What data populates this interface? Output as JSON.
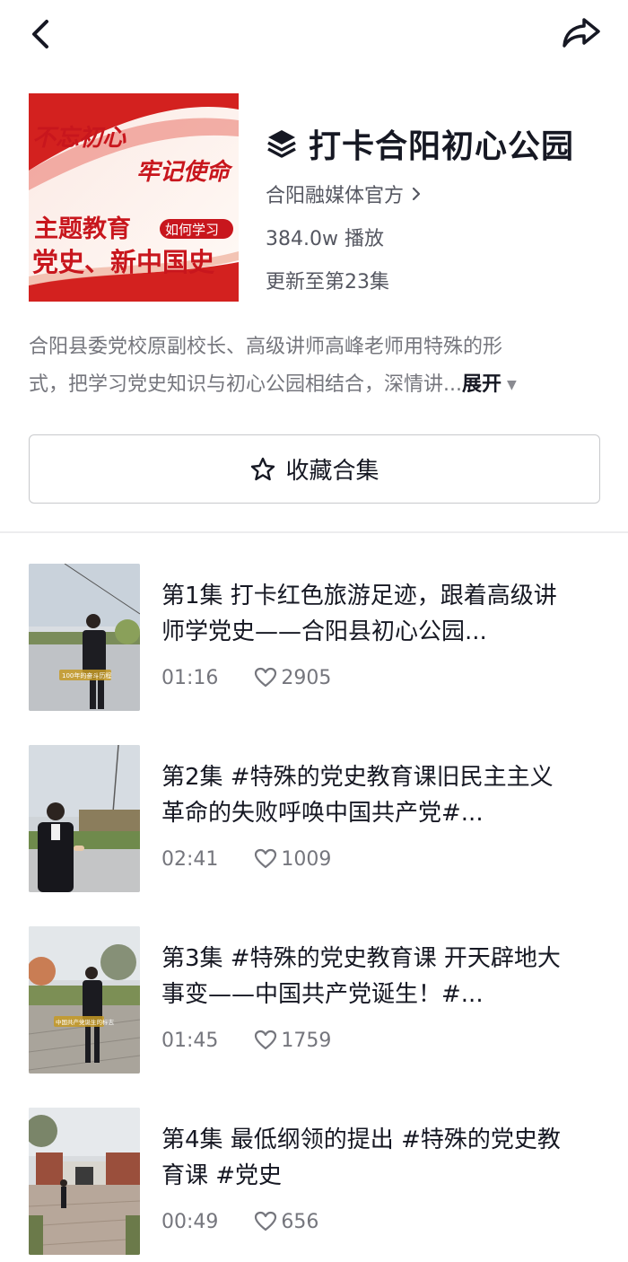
{
  "header": {
    "back_icon": "chevron-left-icon",
    "share_icon": "share-arrow-icon"
  },
  "collection": {
    "cover_lines": {
      "script_top": "不忘初心",
      "script_bottom": "牢记使命",
      "line1": "主题教育",
      "badge": "如何学习",
      "line2": "党史、新中国史"
    },
    "title_icon": "layers-icon",
    "title": "打卡合阳初心公园",
    "author": "合阳融媒体官方",
    "plays": "384.0w 播放",
    "updated": "更新至第23集",
    "description_line1": "合阳县委党校原副校长、高级讲师高峰老师用特殊的形",
    "description_line2": "式，把学习党史知识与初心公园相结合，深情讲...",
    "expand_label": "展开",
    "collect_label": "收藏合集",
    "colors": {
      "primary_text": "#161823",
      "secondary_text": "#75767d",
      "cover_red": "#c8161d"
    }
  },
  "episodes": [
    {
      "title": "第1集  打卡红色旅游足迹，跟着高级讲师学党史——合阳县初心公园...",
      "duration": "01:16",
      "likes": "2905",
      "caption": "100年的奋斗历程"
    },
    {
      "title": "第2集  #特殊的党史教育课旧民主主义革命的失败呼唤中国共产党#...",
      "duration": "02:41",
      "likes": "1009"
    },
    {
      "title": "第3集  #特殊的党史教育课 开天辟地大事变——中国共产党诞生！#...",
      "duration": "01:45",
      "likes": "1759",
      "caption": "中国共产党诞生的标志"
    },
    {
      "title": "第4集  最低纲领的提出 #特殊的党史教育课 #党史",
      "duration": "00:49",
      "likes": "656"
    }
  ]
}
